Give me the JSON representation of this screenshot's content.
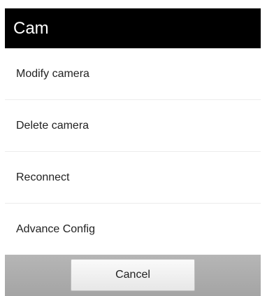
{
  "dialog": {
    "title": "Cam",
    "items": [
      {
        "label": "Modify camera"
      },
      {
        "label": "Delete camera"
      },
      {
        "label": "Reconnect"
      },
      {
        "label": "Advance Config"
      }
    ],
    "cancel_label": "Cancel"
  },
  "colors": {
    "header_bg": "#000000",
    "header_text": "#ffffff",
    "footer_bg": "#a9a9a9"
  }
}
